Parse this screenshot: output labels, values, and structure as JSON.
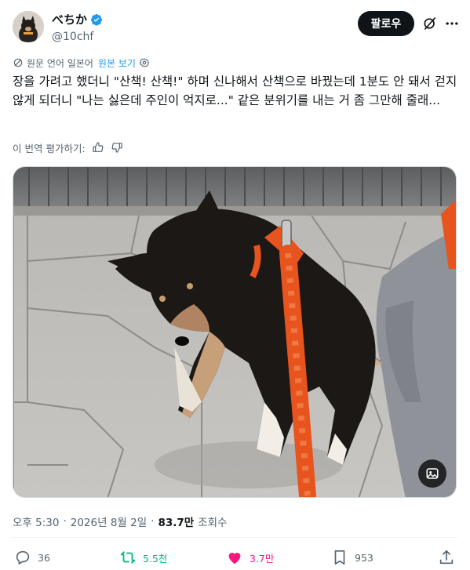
{
  "author": {
    "display_name": "べちか",
    "handle": "@10chf",
    "verified": true,
    "avatar_icon": "shiba-avatar-icon"
  },
  "header": {
    "follow_label": "팔로우",
    "grok_icon": "grok-icon",
    "more_icon": "more-dots-icon"
  },
  "translation": {
    "notice": "원문 언어 일본어",
    "view_original_label": "원본 보기",
    "icons": [
      "translate-icon",
      "settings-gear-icon"
    ]
  },
  "tweet": {
    "text": "장을 가려고 했더니 \"산책! 산책!\" 하며 신나해서 산책으로 바꿨는데 1분도 안 돼서 걷지 않게 되더니 \"나는 싫은데 주인이 억지로...\" 같은 분위기를 내는 거 좀 그만해 줄래..."
  },
  "rate_translation": {
    "label": "이 번역 평가하기:",
    "icons": [
      "thumbs-up-icon",
      "thumbs-down-icon"
    ]
  },
  "media": {
    "alt_button_icon": "image-edit-icon"
  },
  "meta": {
    "time": "오후 5:30",
    "separator1": "·",
    "date": "2026년 8월 2일",
    "separator2": "·",
    "views_count": "83.7만",
    "views_label": "조회수"
  },
  "actions": {
    "replies": "36",
    "retweets": "5.5천",
    "likes": "3.7만",
    "views": "953"
  },
  "colors": {
    "accent": "#1d9bf0",
    "retweet": "#00ba7c",
    "like": "#f91880",
    "text_primary": "#0f1419",
    "text_secondary": "#536471",
    "leash": "#e8541d"
  }
}
